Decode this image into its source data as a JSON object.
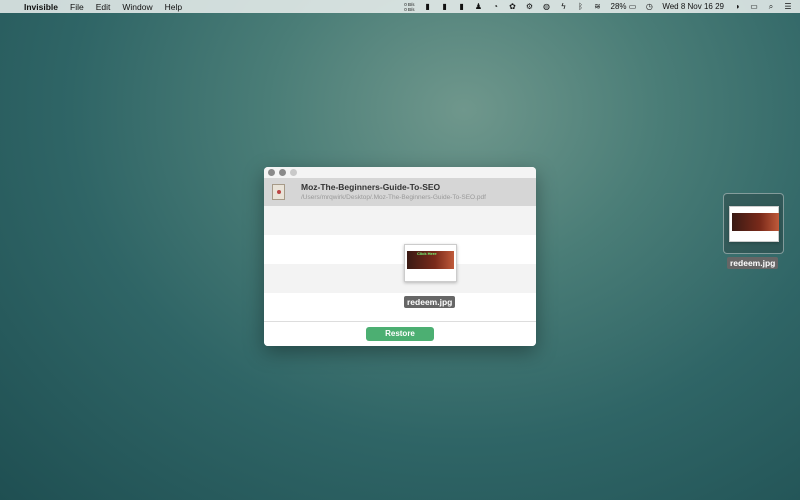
{
  "menubar": {
    "apple": "",
    "app": "Invisible",
    "items": [
      "File",
      "Edit",
      "Window",
      "Help"
    ],
    "net_up": "0 B/s",
    "net_down": "0 B/s",
    "battery": "28%",
    "datetime": "Wed 8 Nov  16 29"
  },
  "window": {
    "file_name": "Moz-The-Beginners-Guide-To-SEO",
    "file_path": "/Users/mrqwirk/Desktop/.Moz-The-Beginners-Guide-To-SEO.pdf",
    "preview_name": "redeem.jpg",
    "preview_caption": "Click Here",
    "restore_label": "Restore",
    "accent": "#4caf72"
  },
  "desktop": {
    "icon_label": "redeem.jpg"
  }
}
